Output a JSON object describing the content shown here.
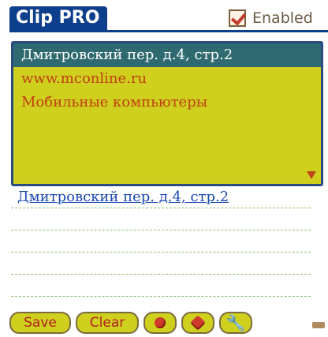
{
  "app": {
    "title": "Clip PRO",
    "enabled_label": "Enabled",
    "enabled_checked": true
  },
  "clips": [
    "Дмитровский пер. д.4, стр.2",
    "www.mconline.ru",
    "Мобильные компьютеры"
  ],
  "selected_clip_index": 0,
  "editor": {
    "text": "Дмитровский пер. д.4, стр.2"
  },
  "toolbar": {
    "save_label": "Save",
    "clear_label": "Clear",
    "up_icon": "red-gem-up-icon",
    "down_icon": "red-gem-down-icon",
    "settings_icon": "wrench-icon"
  },
  "colors": {
    "title_bg": "#0e3f8c",
    "list_bg": "#cfcf1e",
    "selected_bg": "#2e6a70",
    "item_text": "#c04010",
    "editor_text": "#1a4ab0"
  }
}
